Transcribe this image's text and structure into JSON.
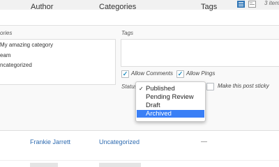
{
  "header": {
    "items_count": "3 item",
    "columns": {
      "author": "Author",
      "categories": "Categories",
      "tags": "Tags"
    }
  },
  "quick_edit": {
    "categories_heading": "ories",
    "categories": [
      "My amazing category",
      "eam",
      "ncategorized"
    ],
    "tags_heading": "Tags",
    "tags_value": "",
    "allow_comments": {
      "label": "Allow Comments",
      "checked": true
    },
    "allow_pings": {
      "label": "Allow Pings",
      "checked": true
    },
    "status_label": "Status",
    "make_sticky": {
      "label": "Make this post sticky",
      "checked": false
    },
    "status_dropdown": {
      "options": [
        "Published",
        "Pending Review",
        "Draft",
        "Archived"
      ],
      "selected": "Published",
      "highlighted": "Archived"
    }
  },
  "row": {
    "author": "Frankie Jarrett",
    "category": "Uncategorized",
    "tags": "—"
  },
  "colors": {
    "link": "#2e6bb0",
    "highlight": "#3a7ff6",
    "checkbox": "#1e8cbe"
  }
}
